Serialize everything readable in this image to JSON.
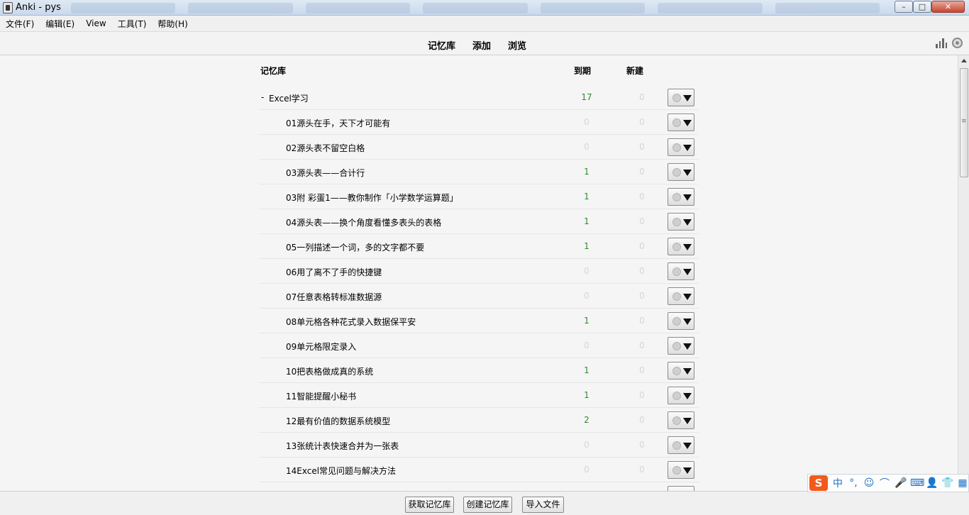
{
  "window": {
    "title": "Anki - pys",
    "min": "–",
    "max": "□",
    "close": "✕"
  },
  "menu": [
    {
      "label": "文件(F)"
    },
    {
      "label": "编辑(E)"
    },
    {
      "label": "View"
    },
    {
      "label": "工具(T)"
    },
    {
      "label": "帮助(H)"
    }
  ],
  "toolbar": {
    "decks": "记忆库",
    "add": "添加",
    "browse": "浏览",
    "stats_icon": "bar-chart-icon",
    "sync_icon": "sync-icon"
  },
  "table": {
    "header": {
      "deck": "记忆库",
      "due": "到期",
      "new": "新建"
    },
    "parent": {
      "toggle": "-",
      "name": "Excel学习",
      "due": "17",
      "new": "0"
    },
    "rows": [
      {
        "name": "01源头在手，天下才可能有",
        "due": "0",
        "new": "0"
      },
      {
        "name": "02源头表不留空白格",
        "due": "0",
        "new": "0"
      },
      {
        "name": "03源头表——合计行",
        "due": "1",
        "new": "0"
      },
      {
        "name": "03附 彩蛋1——教你制作「小学数学运算题」",
        "due": "1",
        "new": "0"
      },
      {
        "name": "04源头表——换个角度看懂多表头的表格",
        "due": "1",
        "new": "0"
      },
      {
        "name": "05一列描述一个词，多的文字都不要",
        "due": "1",
        "new": "0"
      },
      {
        "name": "06用了离不了手的快捷键",
        "due": "0",
        "new": "0"
      },
      {
        "name": "07任意表格转标准数据源",
        "due": "0",
        "new": "0"
      },
      {
        "name": "08单元格各种花式录入数据保平安",
        "due": "1",
        "new": "0"
      },
      {
        "name": "09单元格限定录入",
        "due": "0",
        "new": "0"
      },
      {
        "name": "10把表格做成真的系统",
        "due": "1",
        "new": "0"
      },
      {
        "name": "11智能提醒小秘书",
        "due": "1",
        "new": "0"
      },
      {
        "name": "12最有价值的数据系统模型",
        "due": "2",
        "new": "0"
      },
      {
        "name": "13张统计表快速合并为一张表",
        "due": "0",
        "new": "0"
      },
      {
        "name": "14Excel常见问题与解决方法",
        "due": "0",
        "new": "0"
      },
      {
        "name": "",
        "due": "",
        "new": ""
      }
    ]
  },
  "bottom": {
    "get_shared": "获取记忆库",
    "create": "创建记忆库",
    "import": "导入文件"
  },
  "ime": {
    "logo": "S",
    "mode": "中",
    "punct": "°,",
    "items": [
      "☺",
      "⌒",
      "🎤",
      "⌨",
      "👤",
      "👕",
      "▦"
    ]
  },
  "colors": {
    "due_positive": "#2f8a2f",
    "zero": "#d6d6d6"
  }
}
